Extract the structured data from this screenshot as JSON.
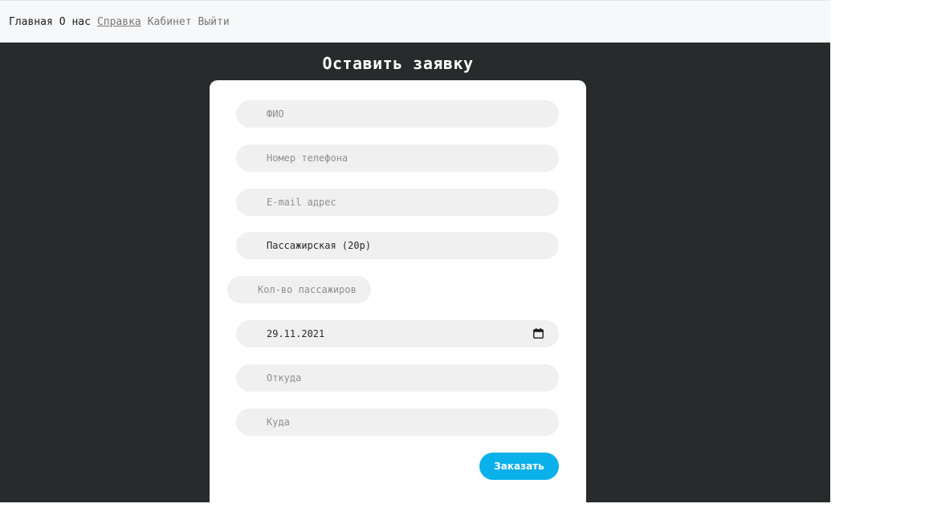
{
  "nav": {
    "home": "Главная",
    "about": "О нас",
    "help": "Справка",
    "cabinet": "Кабинет",
    "logout": "Выйти"
  },
  "form": {
    "title": "Оставить заявку",
    "fields": {
      "fio": {
        "placeholder": "ФИО"
      },
      "phone": {
        "placeholder": "Номер телефона"
      },
      "email": {
        "placeholder": "E-mail адрес"
      },
      "transport": {
        "value": "Пассажирская (20р)"
      },
      "passengers": {
        "placeholder": "Кол-во пассажиров"
      },
      "date": {
        "value": "29.11.2021"
      },
      "from": {
        "placeholder": "Откуда"
      },
      "to": {
        "placeholder": "Куда"
      }
    },
    "submit_label": "Заказать"
  },
  "colors": {
    "nav_bg": "#f7f8fa",
    "main_bg": "#282b2c",
    "field_bg": "#f0f0f0",
    "accent": "#0ab0ea"
  },
  "icons": {
    "date_picker": "calendar-icon"
  }
}
